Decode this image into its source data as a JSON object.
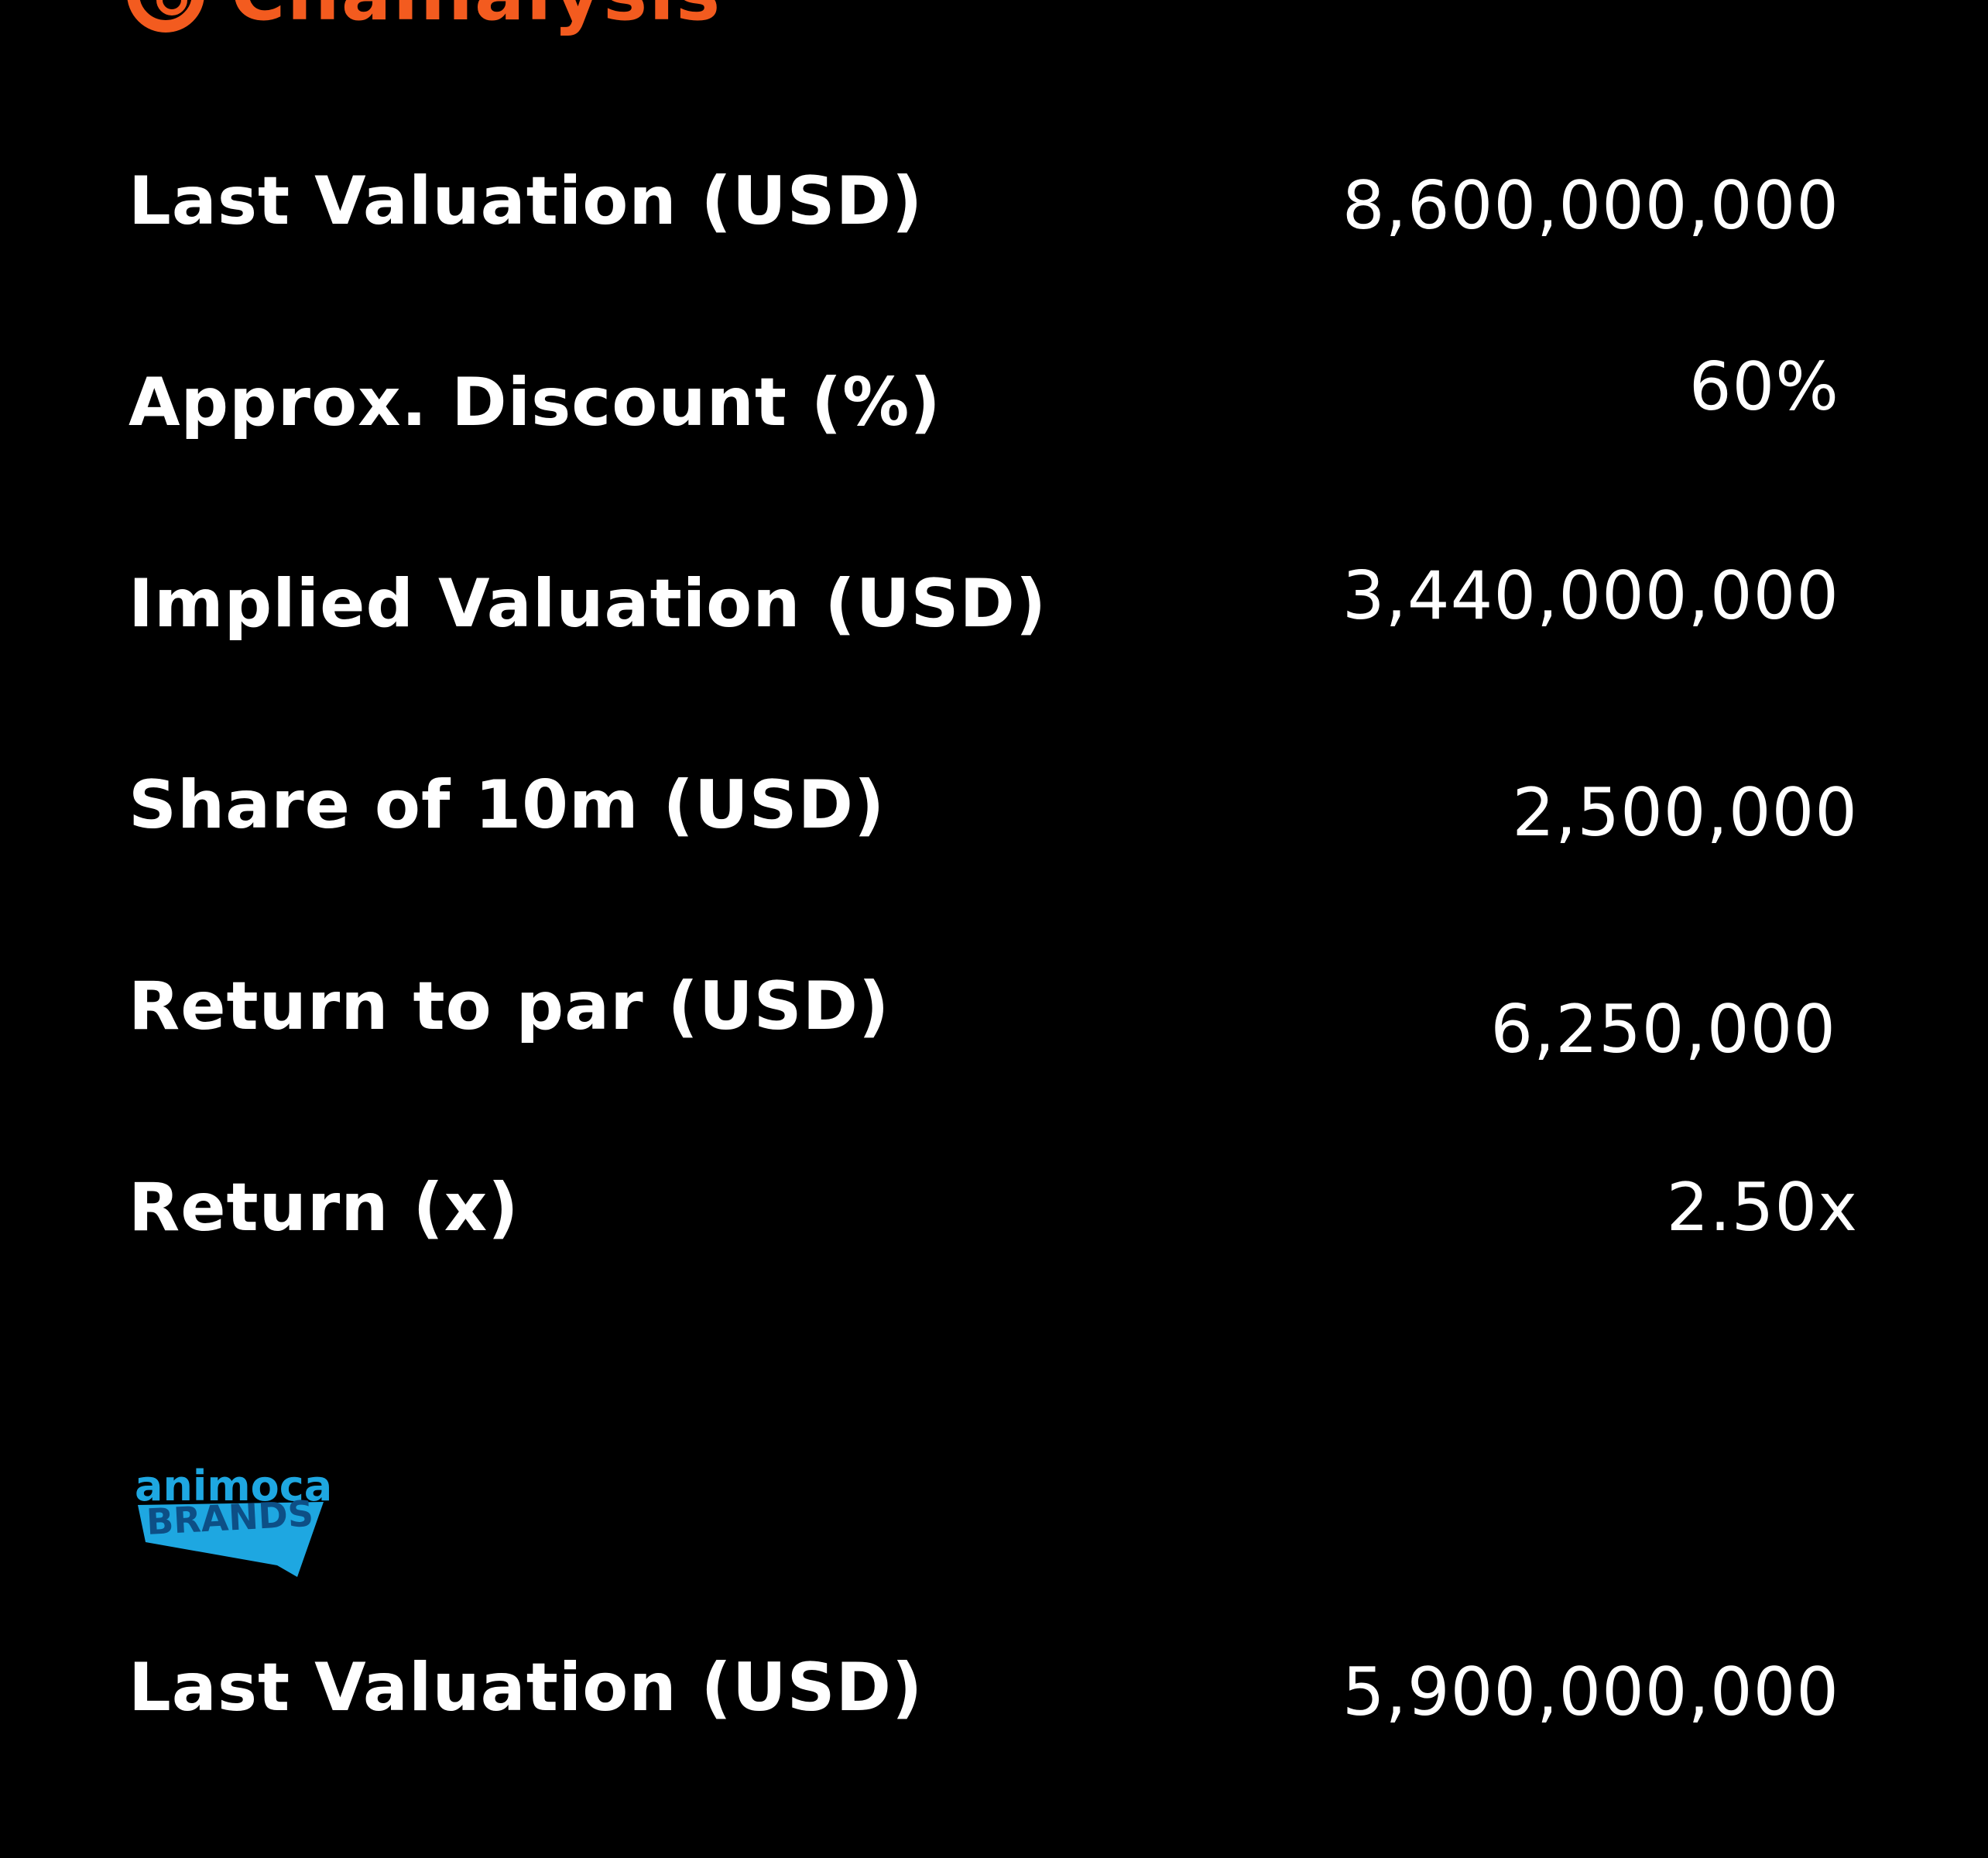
{
  "section_1": {
    "logo_text": "Chainalysis",
    "brand_color": "#f35b1f",
    "rows": [
      {
        "label": "Last Valuation (USD)",
        "value": "8,600,000,000"
      },
      {
        "label": "Approx. Discount (%)",
        "value": "60%"
      },
      {
        "label": "Implied Valuation (USD)",
        "value": "3,440,000,000"
      },
      {
        "label": "Share of 10m (USD)",
        "value": "2,500,000"
      },
      {
        "label": "Return to par (USD)",
        "value": "6,250,000"
      },
      {
        "label": "Return (x)",
        "value": "2.50x"
      }
    ]
  },
  "section_2": {
    "logo_text": "animoca BRANDS",
    "brand_color": "#1ea7e1",
    "rows": [
      {
        "label": "Last Valuation (USD)",
        "value": "5,900,000,000"
      }
    ]
  }
}
